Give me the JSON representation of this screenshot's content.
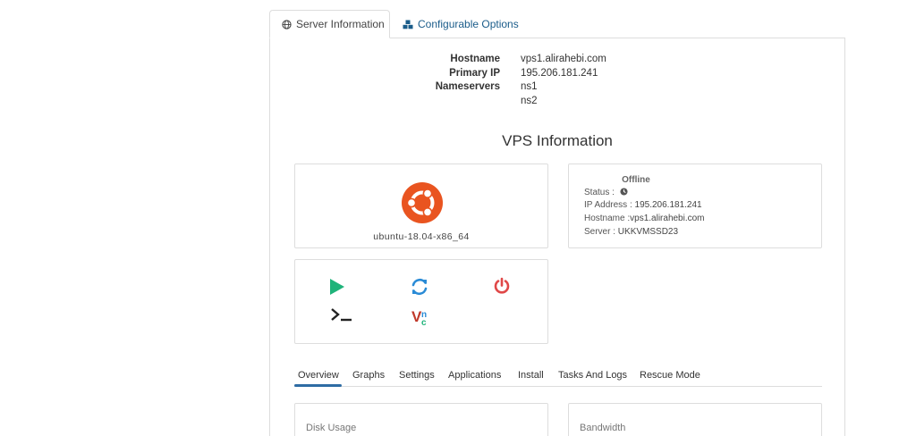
{
  "tabs": [
    {
      "label": "Server Information",
      "icon": "globe-icon",
      "active": true
    },
    {
      "label": "Configurable Options",
      "icon": "cubes-icon",
      "active": false
    }
  ],
  "server_info": {
    "rows": [
      {
        "label": "Hostname",
        "value": "vps1.alirahebi.com"
      },
      {
        "label": "Primary IP",
        "value": "195.206.181.241"
      },
      {
        "label": "Nameservers",
        "value": "ns1"
      },
      {
        "label": "",
        "value": "ns2"
      }
    ]
  },
  "vps": {
    "title": "VPS Information",
    "os_name": "ubuntu-18.04-x86_64",
    "os_icon": "ubuntu-logo",
    "status_heading": "Offline",
    "status_label": "Status :",
    "ip_label": "IP Address :",
    "ip_value": "195.206.181.241",
    "hostname_label": "Hostname :",
    "hostname_value": "vps1.alirahebi.com",
    "server_label": "Server :",
    "server_value": "UKKVMSSD23"
  },
  "actions": [
    {
      "name": "start-icon",
      "color": "#1fb37a"
    },
    {
      "name": "restart-icon",
      "color": "#2a8bd6"
    },
    {
      "name": "power-off-icon",
      "color": "#e04848"
    },
    {
      "name": "console-icon",
      "color": "#222222"
    },
    {
      "name": "vnc-icon",
      "color": "#c0392b"
    }
  ],
  "nav": {
    "items": [
      "Overview",
      "Graphs",
      "Settings",
      "Applications",
      "Install",
      "Tasks And Logs",
      "Rescue Mode"
    ],
    "active": "Overview"
  },
  "widgets": {
    "disk_label": "Disk Usage",
    "bandwidth_label": "Bandwidth"
  },
  "colors": {
    "accent": "#2e6ca4",
    "ubuntu": "#e95420"
  }
}
